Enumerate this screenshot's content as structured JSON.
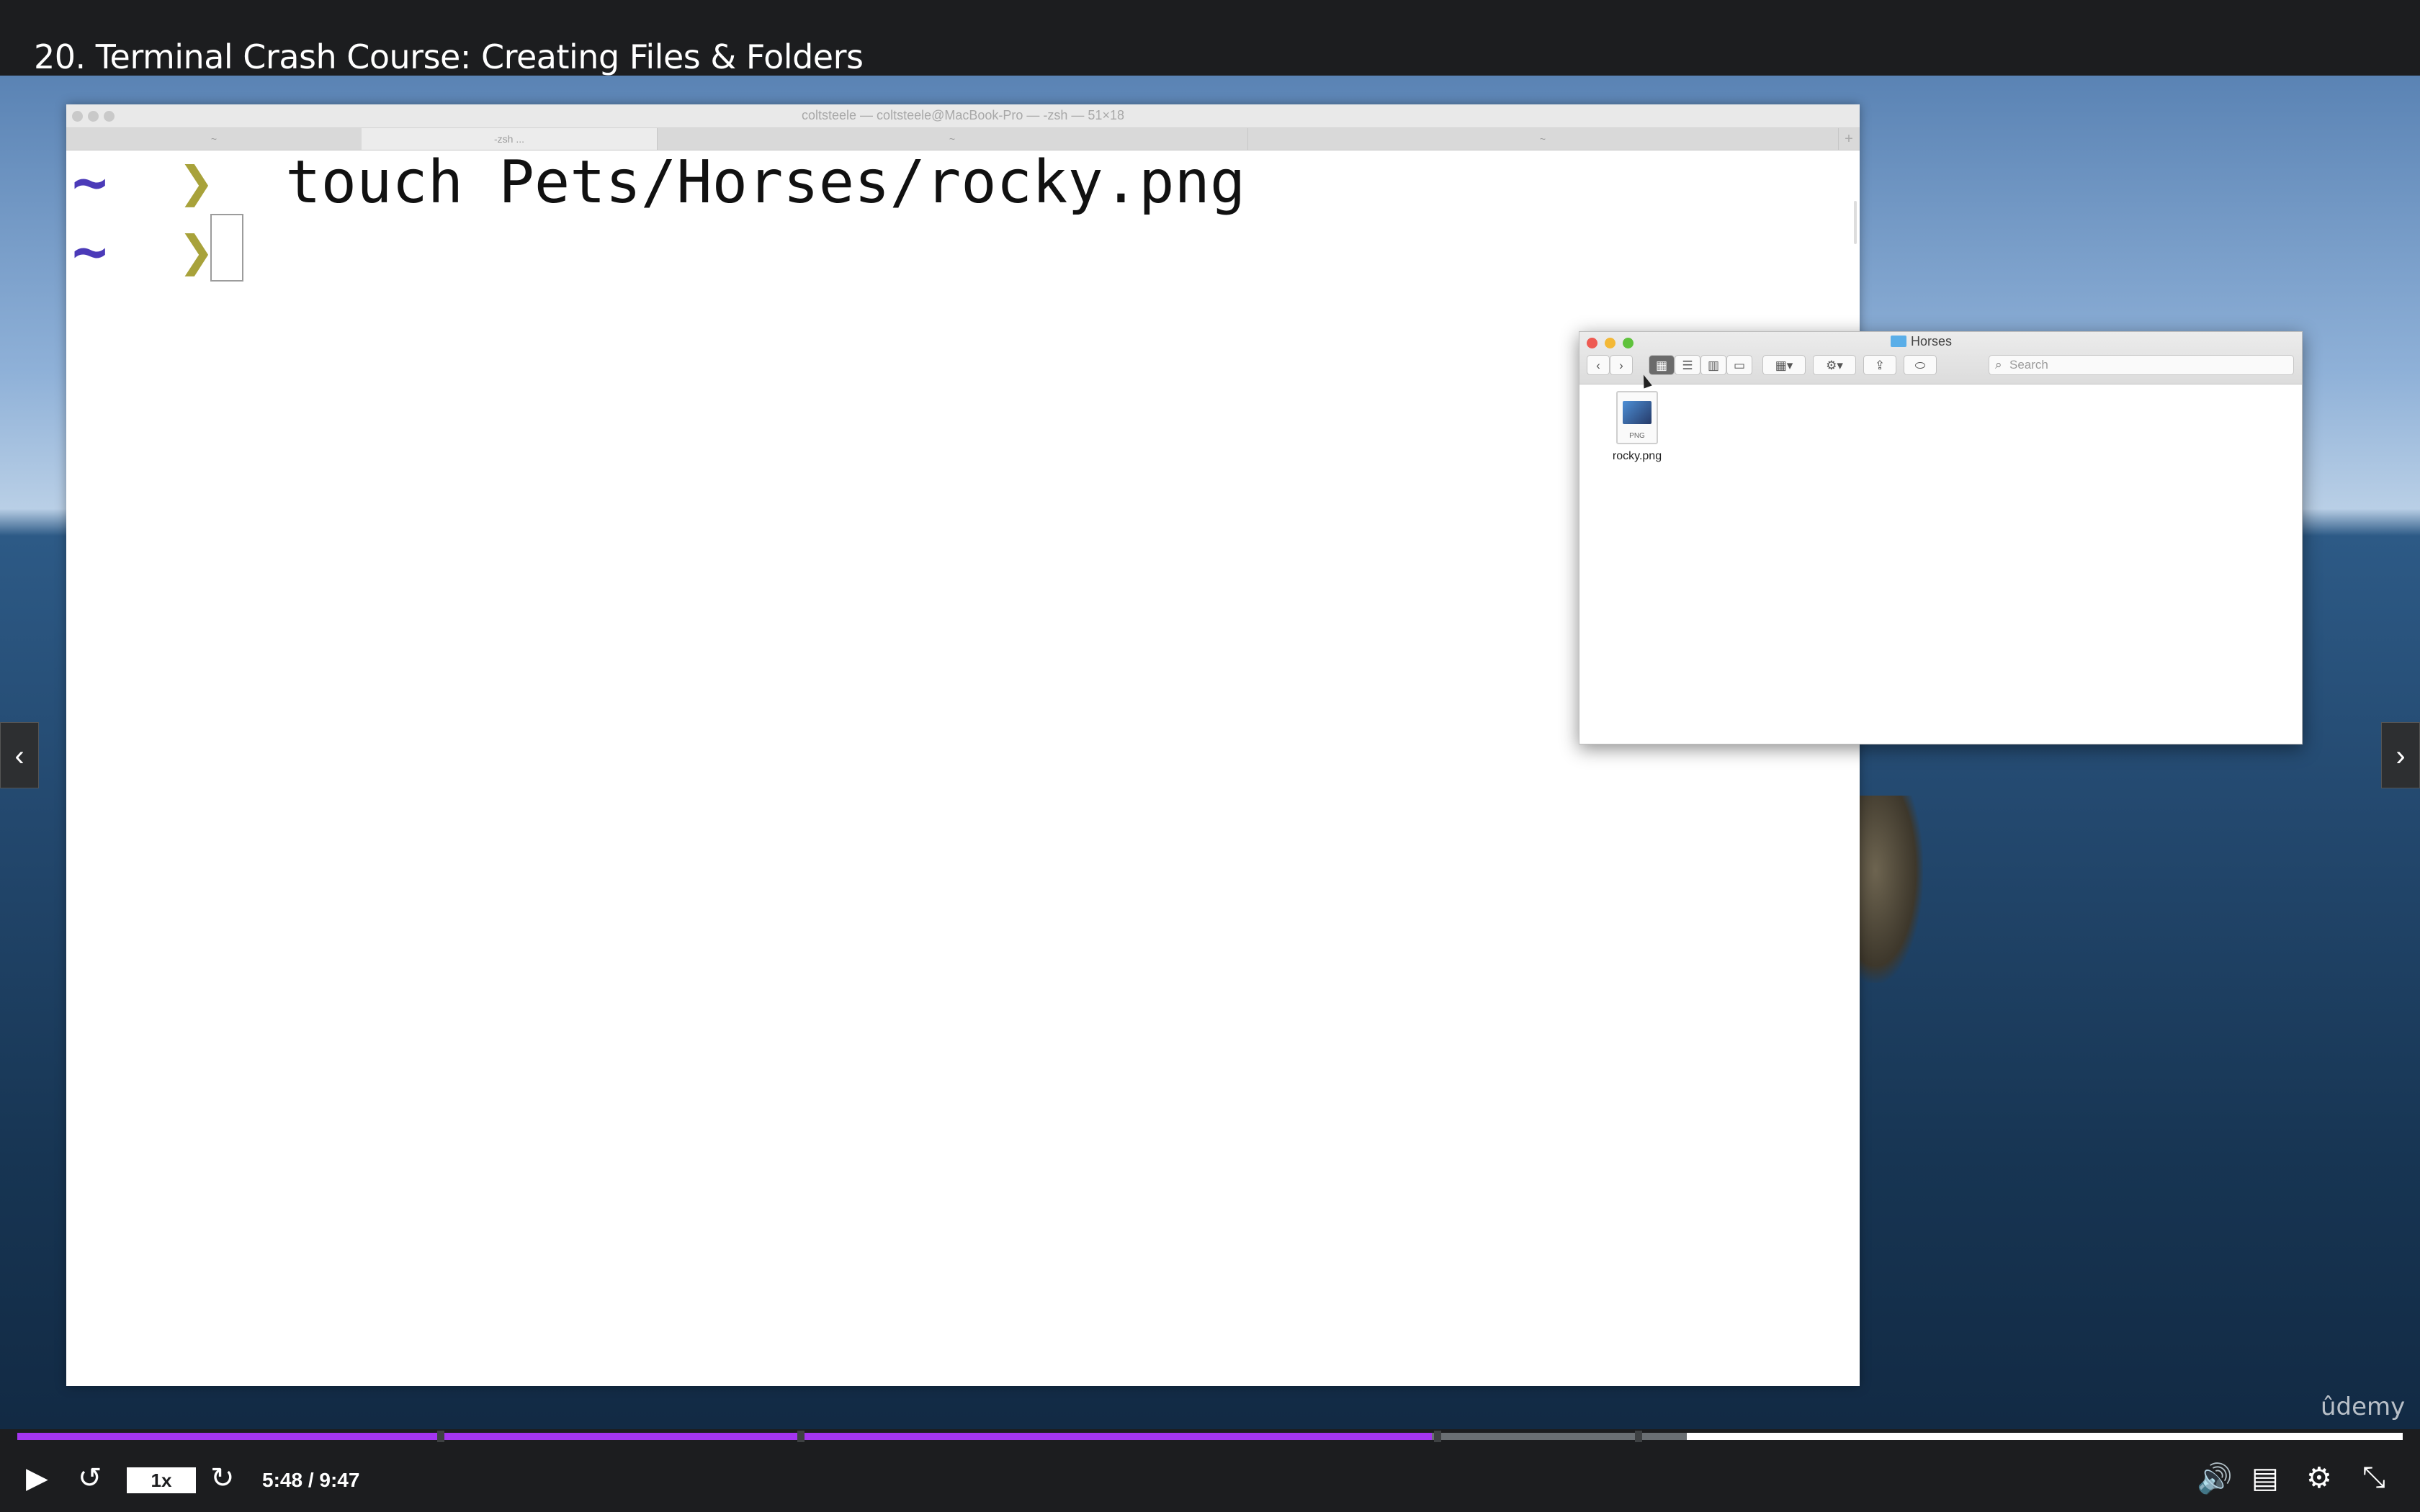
{
  "lecture": {
    "title": "20. Terminal Crash Course: Creating Files & Folders"
  },
  "terminal": {
    "window_title": "coltsteele — coltsteele@MacBook-Pro — -zsh — 51×18",
    "tabs": [
      "~",
      "-zsh ...",
      "~",
      "~"
    ],
    "add_tab": "+",
    "lines": [
      {
        "tilde": "~",
        "arrow": "❯",
        "command": "touch Pets/Horses/rocky.png"
      },
      {
        "tilde": "~",
        "arrow": "❯",
        "command": ""
      }
    ]
  },
  "finder": {
    "title": "Horses",
    "search_placeholder": "Search",
    "files": [
      {
        "name": "rocky.png",
        "ext": "PNG"
      }
    ],
    "buttons": {
      "back": "‹",
      "forward": "›"
    }
  },
  "nav": {
    "prev": "‹",
    "next": "›"
  },
  "brand": "ûdemy",
  "player": {
    "speed": "1x",
    "time": "5:48 / 9:47",
    "progress_played": 0.593,
    "progress_buffered": 0.7,
    "chapter_markers": [
      0.176,
      0.327,
      0.594,
      0.678
    ]
  },
  "colors": {
    "accent": "#a435f0",
    "prompt_tilde": "#4b3ab8",
    "prompt_arrow": "#a8a23a"
  },
  "icons": {
    "play": "play-icon",
    "rewind": "rewind-icon",
    "forward": "forward-icon",
    "volume": "volume-icon",
    "captions": "captions-icon",
    "settings": "gear-icon",
    "fullscreen": "exit-fullscreen-icon"
  }
}
